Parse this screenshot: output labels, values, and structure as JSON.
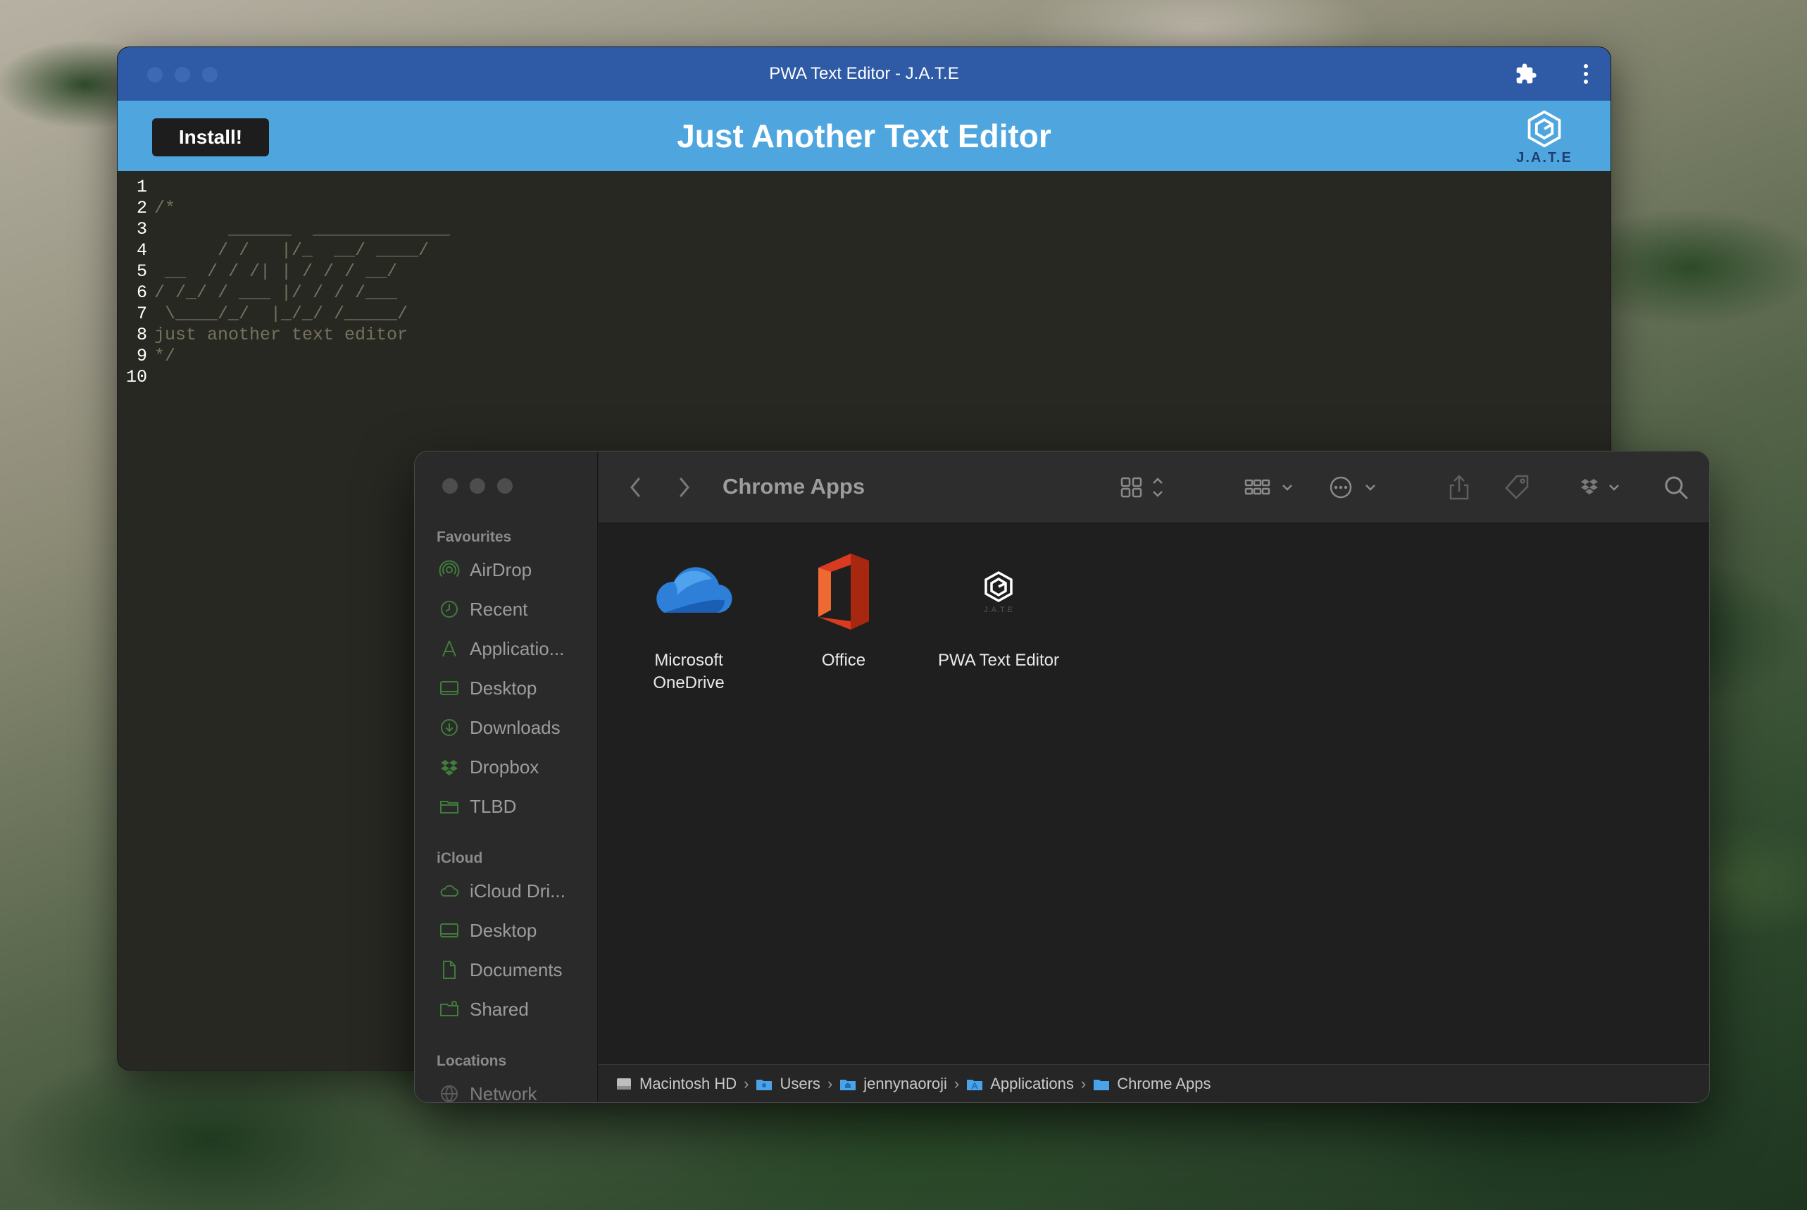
{
  "editor_window": {
    "title": "PWA Text Editor - J.A.T.E",
    "install_label": "Install!",
    "heading": "Just Another Text Editor",
    "logo_text": "J.A.T.E",
    "lines": [
      {
        "n": "1",
        "text": ""
      },
      {
        "n": "2",
        "text": "/*"
      },
      {
        "n": "3",
        "text": "       ______  _____________"
      },
      {
        "n": "4",
        "text": "      / /   |/_  __/ ____/"
      },
      {
        "n": "5",
        "text": " __  / / /| | / / / __/"
      },
      {
        "n": "6",
        "text": "/ /_/ / ___ |/ / / /___"
      },
      {
        "n": "7",
        "text": " \\____/_/  |_/_/ /_____/"
      },
      {
        "n": "8",
        "text": "just another text editor"
      },
      {
        "n": "9",
        "text": "*/"
      },
      {
        "n": "10",
        "text": ""
      }
    ]
  },
  "finder": {
    "title": "Chrome Apps",
    "sections": {
      "favourites": "Favourites",
      "icloud": "iCloud",
      "locations": "Locations"
    },
    "favourites": [
      {
        "label": "AirDrop",
        "icon": "airdrop-icon"
      },
      {
        "label": "Recent",
        "icon": "clock-icon"
      },
      {
        "label": "Applicatio...",
        "icon": "applications-icon"
      },
      {
        "label": "Desktop",
        "icon": "desktop-icon"
      },
      {
        "label": "Downloads",
        "icon": "download-icon"
      },
      {
        "label": "Dropbox",
        "icon": "dropbox-icon"
      },
      {
        "label": "TLBD",
        "icon": "folder-icon"
      }
    ],
    "icloud": [
      {
        "label": "iCloud Dri...",
        "icon": "cloud-icon"
      },
      {
        "label": "Desktop",
        "icon": "desktop-icon"
      },
      {
        "label": "Documents",
        "icon": "document-icon"
      },
      {
        "label": "Shared",
        "icon": "shared-folder-icon"
      }
    ],
    "locations": [
      {
        "label": "Network",
        "icon": "network-icon"
      }
    ],
    "files": [
      {
        "label_line1": "Microsoft",
        "label_line2": "OneDrive",
        "icon": "onedrive-icon"
      },
      {
        "label_line1": "Office",
        "label_line2": "",
        "icon": "office-icon"
      },
      {
        "label_line1": "PWA Text Editor",
        "label_line2": "",
        "icon": "jate-app-icon"
      }
    ],
    "path": [
      "Macintosh HD",
      "Users",
      "jennynaoroji",
      "Applications",
      "Chrome Apps"
    ],
    "path_separator": "›"
  },
  "colors": {
    "editor_titlebar": "#2f5aa6",
    "editor_header": "#4fa6df",
    "editor_background": "#272822",
    "sidebar_icon_green": "#3f7d3a"
  }
}
